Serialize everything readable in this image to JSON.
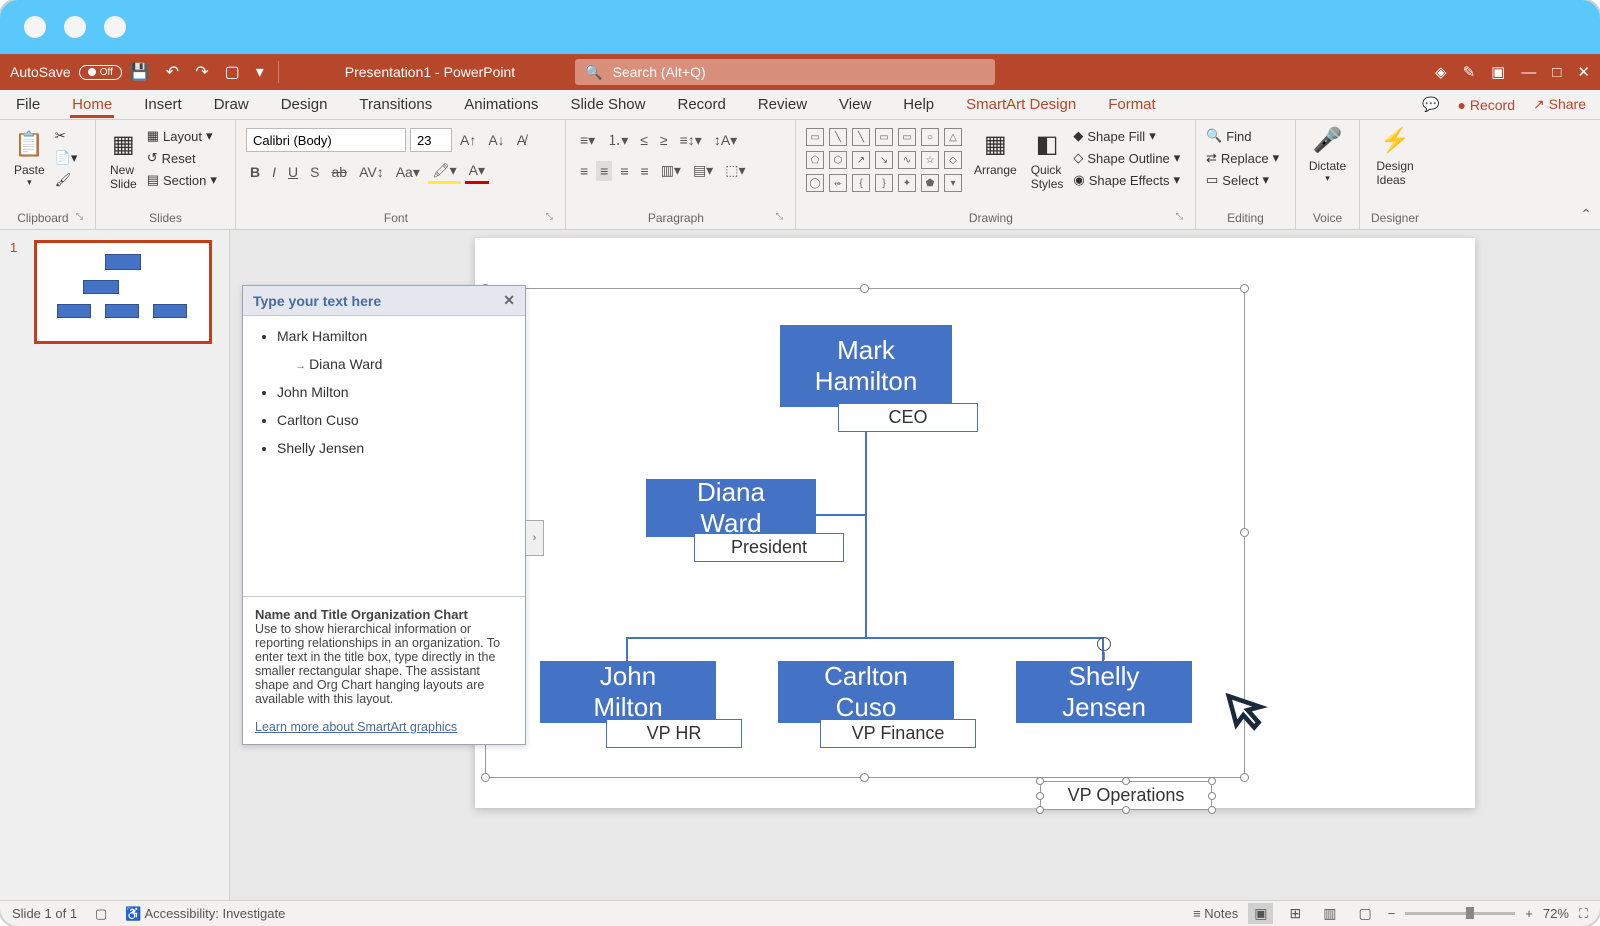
{
  "titlebar": {
    "autosave_label": "AutoSave",
    "autosave_state": "Off",
    "app_title": "Presentation1 - PowerPoint",
    "search_placeholder": "Search (Alt+Q)"
  },
  "tabs": {
    "file": "File",
    "home": "Home",
    "insert": "Insert",
    "draw": "Draw",
    "design": "Design",
    "transitions": "Transitions",
    "animations": "Animations",
    "slideshow": "Slide Show",
    "record_tab": "Record",
    "review": "Review",
    "view": "View",
    "help": "Help",
    "smartart": "SmartArt Design",
    "format": "Format",
    "record_btn": "Record",
    "share": "Share"
  },
  "ribbon": {
    "clipboard": {
      "label": "Clipboard",
      "paste": "Paste"
    },
    "slides": {
      "label": "Slides",
      "new_slide": "New\nSlide",
      "layout": "Layout",
      "reset": "Reset",
      "section": "Section"
    },
    "font": {
      "label": "Font",
      "family": "Calibri (Body)",
      "size": "23"
    },
    "paragraph": {
      "label": "Paragraph"
    },
    "drawing": {
      "label": "Drawing",
      "arrange": "Arrange",
      "quick_styles": "Quick\nStyles",
      "shape_fill": "Shape Fill",
      "shape_outline": "Shape Outline",
      "shape_effects": "Shape Effects"
    },
    "editing": {
      "label": "Editing",
      "find": "Find",
      "replace": "Replace",
      "select": "Select"
    },
    "voice": {
      "label": "Voice",
      "dictate": "Dictate"
    },
    "designer": {
      "label": "Designer",
      "ideas": "Design\nIdeas"
    }
  },
  "slides_panel": {
    "number": "1"
  },
  "text_pane": {
    "header": "Type your text here",
    "items": [
      "Mark Hamilton",
      "Diana Ward",
      "John Milton",
      "Carlton Cuso",
      "Shelly Jensen"
    ],
    "desc_title": "Name and Title Organization Chart",
    "desc_body": "Use to show hierarchical information or reporting relationships in an organization. To enter text in the title box, type directly in the smaller rectangular shape. The assistant shape and Org Chart hanging layouts are available with this layout.",
    "desc_link": "Learn more about SmartArt graphics"
  },
  "org_chart": {
    "ceo": {
      "name": "Mark Hamilton",
      "title": "CEO"
    },
    "president": {
      "name": "Diana Ward",
      "title": "President"
    },
    "vp1": {
      "name": "John Milton",
      "title": "VP HR"
    },
    "vp2": {
      "name": "Carlton Cuso",
      "title": "VP Finance"
    },
    "vp3": {
      "name": "Shelly Jensen",
      "title": "VP Operations"
    }
  },
  "status": {
    "slide_info": "Slide 1 of 1",
    "accessibility": "Accessibility: Investigate",
    "notes": "Notes",
    "zoom": "72%"
  }
}
